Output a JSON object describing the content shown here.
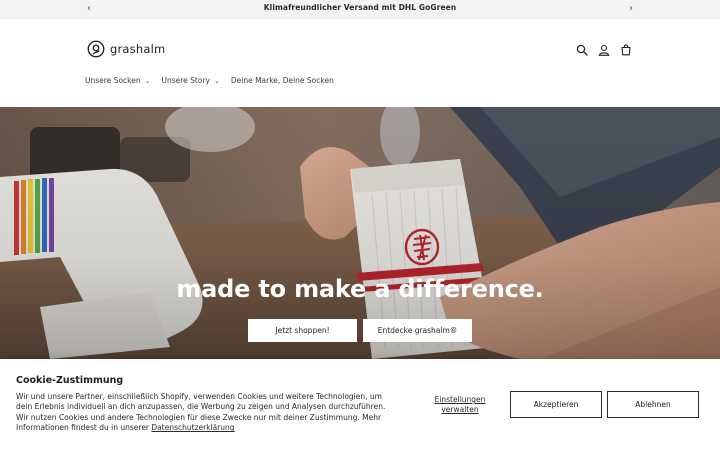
{
  "announcement": {
    "text": "Klimafreundlicher Versand mit DHL GoGreen",
    "prev_icon": "chevron-left-icon",
    "next_icon": "chevron-right-icon"
  },
  "header": {
    "logo_text": "grashalm",
    "icons": [
      "search-icon",
      "account-icon",
      "cart-icon"
    ]
  },
  "nav": {
    "items": [
      {
        "label": "Unsere Socken",
        "has_dropdown": true
      },
      {
        "label": "Unsere Story",
        "has_dropdown": true
      },
      {
        "label": "Deine Marke, Deine Socken",
        "has_dropdown": false
      }
    ]
  },
  "hero": {
    "headline": "made to make a difference.",
    "primary_button": "Jetzt shoppen!",
    "secondary_button": "Entdecke grashalm®"
  },
  "cookie": {
    "title": "Cookie-Zustimmung",
    "description": "Wir und unsere Partner, einschließlich Shopify, verwenden Cookies und weitere Technologien, um dein Erlebnis individuell an dich anzupassen, die Werbung zu zeigen und Analysen durchzuführen. Wir nutzen Cookies und andere Technologien für diese Zwecke nur mit deiner Zustimmung. Mehr Informationen findest du in unserer",
    "privacy_link": "Datenschutzerklärung",
    "settings_label": "Einstellungen verwalten",
    "accept_label": "Akzeptieren",
    "decline_label": "Ablehnen"
  },
  "colors": {
    "announcement_bg": "#f3f3f3",
    "text": "#1f1f1f",
    "sock_stripe": "#c2282f"
  }
}
